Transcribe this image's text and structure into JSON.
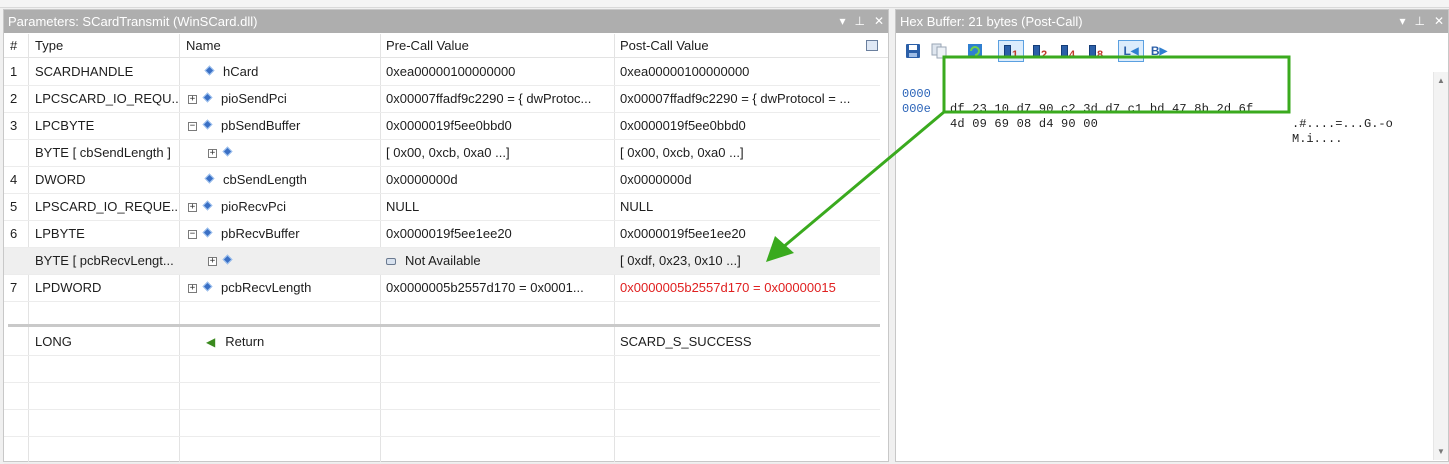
{
  "left_panel": {
    "title": "Parameters: SCardTransmit (WinSCard.dll)",
    "columns": [
      "#",
      "Type",
      "Name",
      "Pre-Call Value",
      "Post-Call Value"
    ],
    "rows": [
      {
        "num": "1",
        "type": "SCARDHANDLE",
        "name": "hCard",
        "pre": "0xea00000100000000",
        "post": "0xea00000100000000"
      },
      {
        "num": "2",
        "type": "LPCSCARD_IO_REQU...",
        "name": "pioSendPci",
        "pre": "0x00007ffadf9c2290 = { dwProtoc...",
        "post": "0x00007ffadf9c2290 = { dwProtocol = ..."
      },
      {
        "num": "3",
        "type": "LPCBYTE",
        "name": "pbSendBuffer",
        "pre": "0x0000019f5ee0bbd0",
        "post": "0x0000019f5ee0bbd0"
      },
      {
        "num": "",
        "type": "BYTE [ cbSendLength ]",
        "name": "",
        "pre": "[ 0x00, 0xcb, 0xa0  ...]",
        "post": "[ 0x00, 0xcb, 0xa0  ...]"
      },
      {
        "num": "4",
        "type": "DWORD",
        "name": "cbSendLength",
        "pre": "0x0000000d",
        "post": "0x0000000d"
      },
      {
        "num": "5",
        "type": "LPSCARD_IO_REQUE...",
        "name": "pioRecvPci",
        "pre": "NULL",
        "post": "NULL"
      },
      {
        "num": "6",
        "type": "LPBYTE",
        "name": "pbRecvBuffer",
        "pre": "0x0000019f5ee1ee20",
        "post": "0x0000019f5ee1ee20"
      },
      {
        "num": "",
        "type": "BYTE [ pcbRecvLengt...",
        "name": "",
        "pre": "Not Available",
        "post": "[ 0xdf, 0x23, 0x10  ...]"
      },
      {
        "num": "7",
        "type": "LPDWORD",
        "name": "pcbRecvLength",
        "pre": "0x0000005b2557d170 = 0x0001...",
        "post": "0x0000005b2557d170 = 0x00000015"
      }
    ],
    "return_row": {
      "type": "LONG",
      "name": "Return",
      "pre": "",
      "post": "SCARD_S_SUCCESS"
    },
    "highlight_color": "#e02020"
  },
  "right_panel": {
    "title": "Hex Buffer: 21 bytes (Post-Call)",
    "toolbar": {
      "b1": "1",
      "b2": "2",
      "b4": "4",
      "b8": "8",
      "little": "L",
      "big": "B"
    },
    "hex": [
      {
        "offset": "0000",
        "bytes": "df 23 10 d7 90 c2 3d d7 c1 bd 47 8b 2d 6f",
        "ascii": ".#....=...G.-o"
      },
      {
        "offset": "000e",
        "bytes": "4d 09 69 08 d4 90 00",
        "ascii": "M.i...."
      }
    ]
  },
  "window_buttons": {
    "dropdown": "▾",
    "pin": "⊥",
    "close": "✕"
  },
  "annotation_color": "#3aaa1e"
}
